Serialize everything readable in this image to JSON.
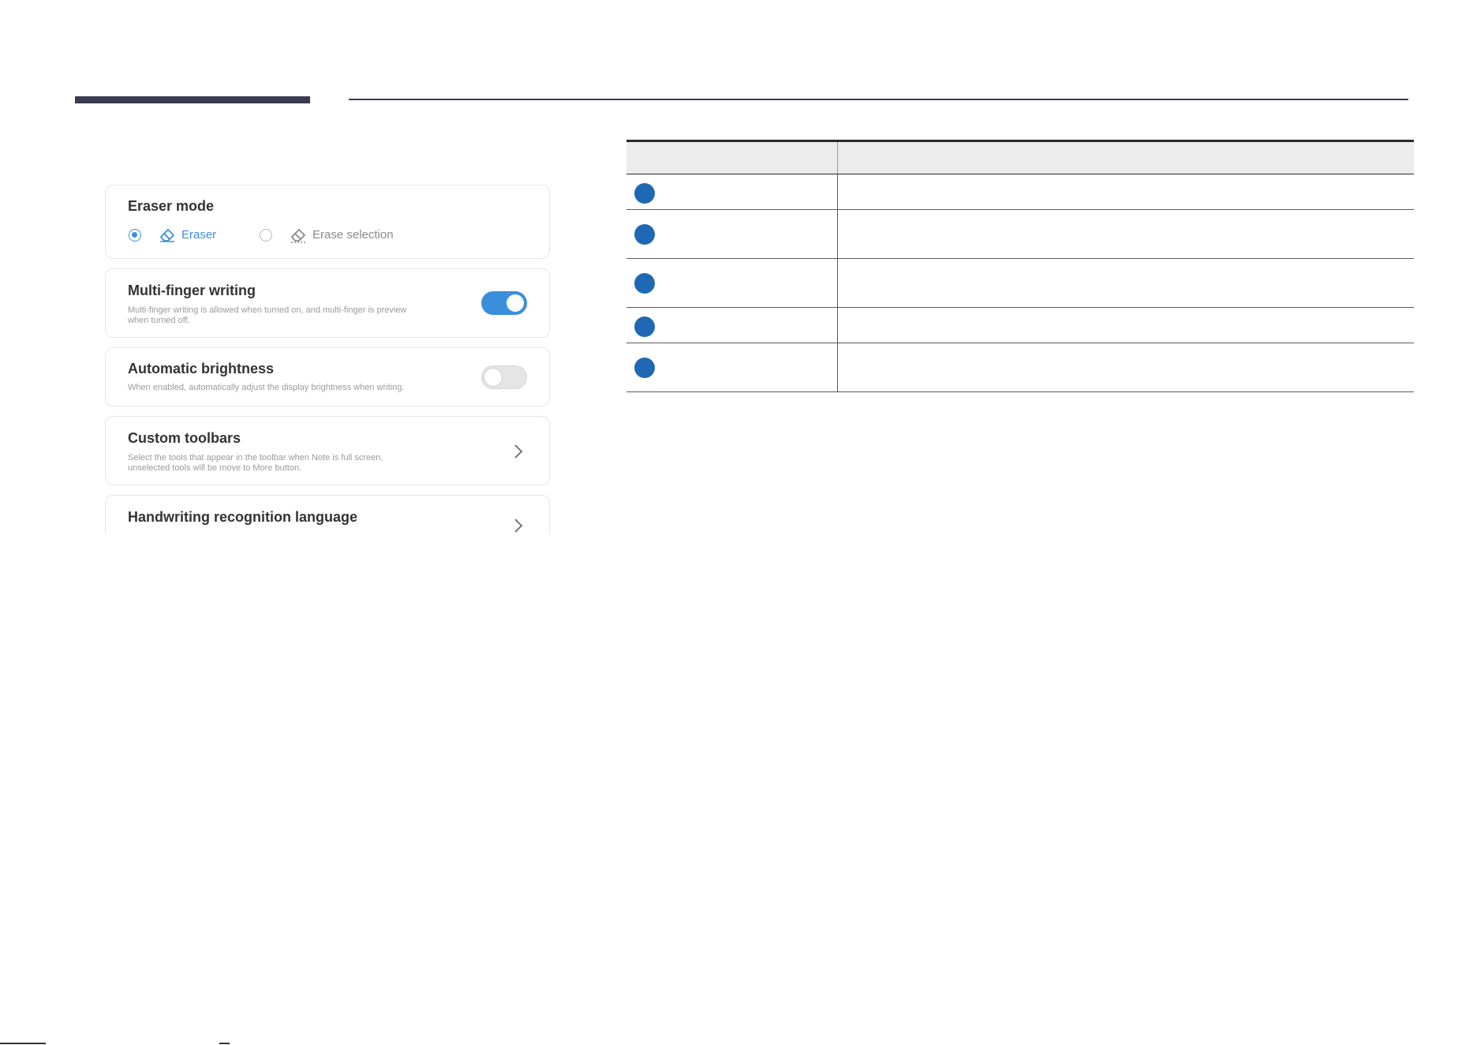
{
  "settings": {
    "eraser_mode": {
      "title": "Eraser mode",
      "options": [
        {
          "label": "Eraser",
          "selected": true,
          "icon": "eraser-icon"
        },
        {
          "label": "Erase selection",
          "selected": false,
          "icon": "erase-selection-icon"
        }
      ]
    },
    "multi_finger": {
      "title": "Multi-finger writing",
      "description_line1": "Multi-finger writing is allowed when turned on, and multi-finger is preview",
      "description_line2": "when turned off.",
      "toggle_on": true
    },
    "auto_brightness": {
      "title": "Automatic brightness",
      "description": "When enabled, automatically adjust the display brightness when writing.",
      "toggle_on": false
    },
    "custom_toolbars": {
      "title": "Custom toolbars",
      "description_line1": "Select the tools that appear in the toolbar when Note is full screen,",
      "description_line2": "unselected tools will be move to More button."
    },
    "handwriting": {
      "title": "Handwriting recognition language"
    }
  },
  "colors": {
    "accent": "#3a8fdc",
    "badge": "#1f69b4",
    "heading_bar": "#3b3b4f"
  },
  "reference_table": {
    "rows": 5
  }
}
